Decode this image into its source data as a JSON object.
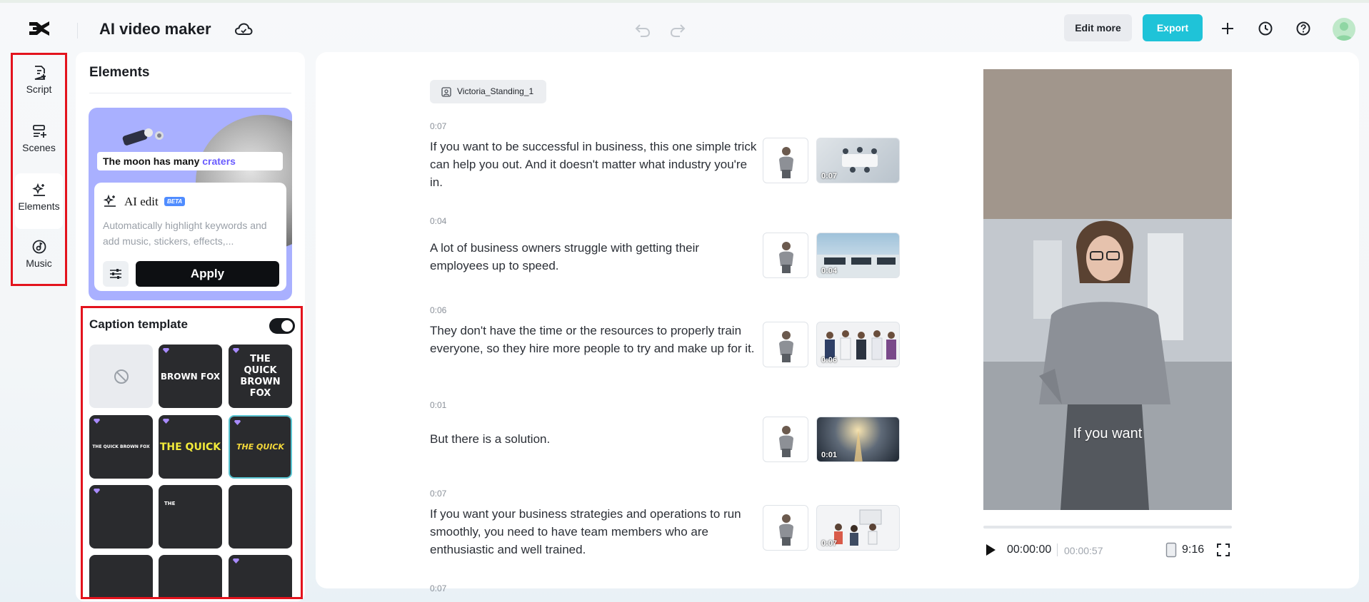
{
  "header": {
    "app_title": "AI video maker",
    "edit_more_label": "Edit more",
    "export_label": "Export",
    "accent_color": "#1fc3d8"
  },
  "nav": {
    "items": [
      {
        "label": "Script",
        "icon": "script-icon"
      },
      {
        "label": "Scenes",
        "icon": "scenes-icon"
      },
      {
        "label": "Elements",
        "icon": "elements-icon",
        "active": true
      },
      {
        "label": "Music",
        "icon": "music-icon"
      }
    ]
  },
  "elements_panel": {
    "title": "Elements",
    "promo": {
      "caption_text": "The moon has many",
      "caption_highlight": "craters",
      "ai_edit_label": "AI edit",
      "beta_label": "BETA",
      "description": "Automatically highlight keywords and add music, stickers, effects,...",
      "apply_label": "Apply"
    },
    "caption_template": {
      "title": "Caption template",
      "enabled": true,
      "templates": [
        {
          "name": "none"
        },
        {
          "text": "BROWN FOX"
        },
        {
          "text": "THE QUICK BROWN FOX"
        },
        {
          "text": "THE QUICK BROWN FOX"
        },
        {
          "text": "THE QUICK"
        },
        {
          "text": "THE QUICK",
          "selected": true
        },
        {
          "text": ""
        },
        {
          "text": "THE"
        },
        {
          "text": ""
        },
        {
          "text": ""
        },
        {
          "text": ""
        },
        {
          "text": ""
        }
      ]
    }
  },
  "script": {
    "avatar_name": "Victoria_Standing_1",
    "segments": [
      {
        "time": "0:07",
        "text": "If you want to be successful in business, this one simple trick can help you out. And it doesn't matter what industry you're in.",
        "duration": "0:07"
      },
      {
        "time": "0:04",
        "text": "A lot of business owners struggle with getting their employees up to speed.",
        "duration": "0:04"
      },
      {
        "time": "0:06",
        "text": "They don't have the time or the resources to properly train everyone, so they hire more people to try and make up for it.",
        "duration": "0:06"
      },
      {
        "time": "0:01",
        "text": "But there is a solution.",
        "duration": "0:01"
      },
      {
        "time": "0:07",
        "text": "If you want your business strategies and operations to run smoothly, you need to have team members who are enthusiastic and well trained.",
        "duration": "0:07"
      },
      {
        "time": "0:07",
        "text": "",
        "duration": ""
      }
    ]
  },
  "preview": {
    "caption": "If you want",
    "current_time": "00:00:00",
    "total_time": "00:00:57",
    "aspect_ratio": "9:16"
  }
}
